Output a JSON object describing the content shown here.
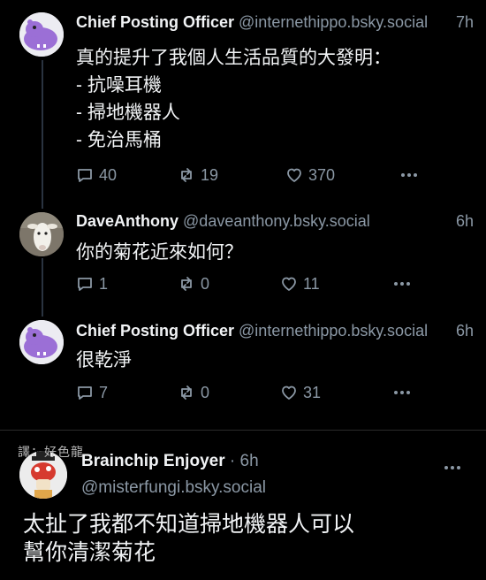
{
  "posts": [
    {
      "author": "Chief Posting Officer",
      "handle": "@internethippo.bsky.social",
      "time": "7h",
      "lines": [
        "真的提升了我個人生活品質的大發明：",
        "- 抗噪耳機",
        "- 掃地機器人",
        "- 免治馬桶"
      ],
      "replies": "40",
      "reposts": "19",
      "likes": "370"
    },
    {
      "author": "DaveAnthony",
      "handle": "@daveanthony.bsky.social",
      "time": "6h",
      "lines": [
        "你的菊花近來如何？"
      ],
      "replies": "1",
      "reposts": "0",
      "likes": "11"
    },
    {
      "author": "Chief Posting Officer",
      "handle": "@internethippo.bsky.social",
      "time": "6h",
      "lines": [
        "很乾淨"
      ],
      "replies": "7",
      "reposts": "0",
      "likes": "31"
    }
  ],
  "reply": {
    "author": "Brainchip Enjoyer",
    "time_prefix": "· ",
    "time": "6h",
    "handle": "@misterfungi.bsky.social",
    "lines": [
      "太扯了我都不知道掃地機器人可以",
      "幫你清潔菊花"
    ]
  },
  "watermark": "譯：好色龍",
  "colors": {
    "background": "#000000",
    "secondary_text": "#8b98a5",
    "hippo": "#9b6fd6"
  }
}
